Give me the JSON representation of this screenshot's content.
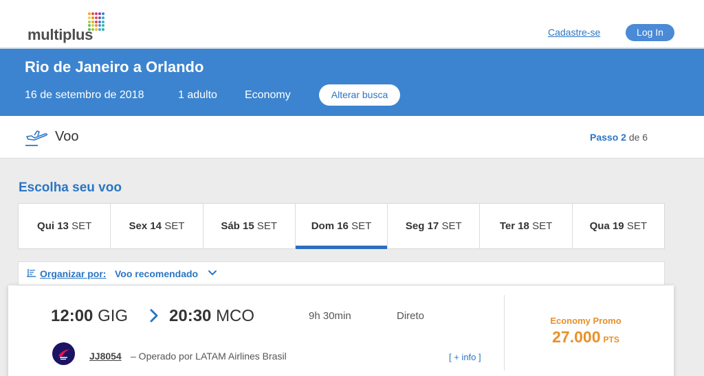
{
  "header": {
    "logo_text": "multiplus",
    "logo_dot_colors": [
      "#f6a623",
      "#e94e3c",
      "#d23a7a",
      "#8e44ad",
      "#3c84cf",
      "#f7c948",
      "#f28b30",
      "#e04b5a",
      "#7b4fa0",
      "#2fa8d8",
      "#a6cf45",
      "#f3a33b",
      "#d64461",
      "#5b6dc2",
      "#38b6c8",
      "#6fbf4a",
      "#c9d43e",
      "#f08a3a",
      "#4d8fd6",
      "#39b7a5",
      "#5cb85c",
      "#9bc53d",
      "#f4b942",
      "#4ba3e3",
      "#2bb6b0"
    ],
    "signup_label": "Cadastre-se",
    "login_label": "Log In"
  },
  "search": {
    "route_title": "Rio de Janeiro a Orlando",
    "date": "16 de setembro de 2018",
    "passengers": "1 adulto",
    "cabin": "Economy",
    "alter_label": "Alterar busca"
  },
  "step": {
    "icon": "plane-takeoff-icon",
    "label": "Voo",
    "prefix": "Passo",
    "current": "2",
    "separator": "de",
    "total": "6"
  },
  "choose_title": "Escolha seu voo",
  "date_tabs": [
    {
      "day": "Qui 13",
      "month": "SET"
    },
    {
      "day": "Sex 14",
      "month": "SET"
    },
    {
      "day": "Sáb 15",
      "month": "SET"
    },
    {
      "day": "Dom 16",
      "month": "SET",
      "active": true
    },
    {
      "day": "Seg 17",
      "month": "SET"
    },
    {
      "day": "Ter 18",
      "month": "SET"
    },
    {
      "day": "Qua 19",
      "month": "SET"
    }
  ],
  "sort": {
    "label": "Organizar por:",
    "value": "Voo recomendado"
  },
  "flight": {
    "departure_time": "12:00",
    "departure_airport": "GIG",
    "arrival_time": "20:30",
    "arrival_airport": "MCO",
    "duration": "9h 30min",
    "stops": "Direto",
    "flight_number": "JJ8054",
    "operated_by": "– Operado por LATAM Airlines Brasil",
    "more_info": "[ + info ]",
    "fare_class": "Economy Promo",
    "fare_amount": "27.000",
    "fare_unit": "PTS"
  },
  "colors": {
    "brand_blue": "#3c84cf",
    "link_blue": "#2a75c4",
    "fare_orange": "#e8902a",
    "airline_navy": "#1b1464"
  }
}
